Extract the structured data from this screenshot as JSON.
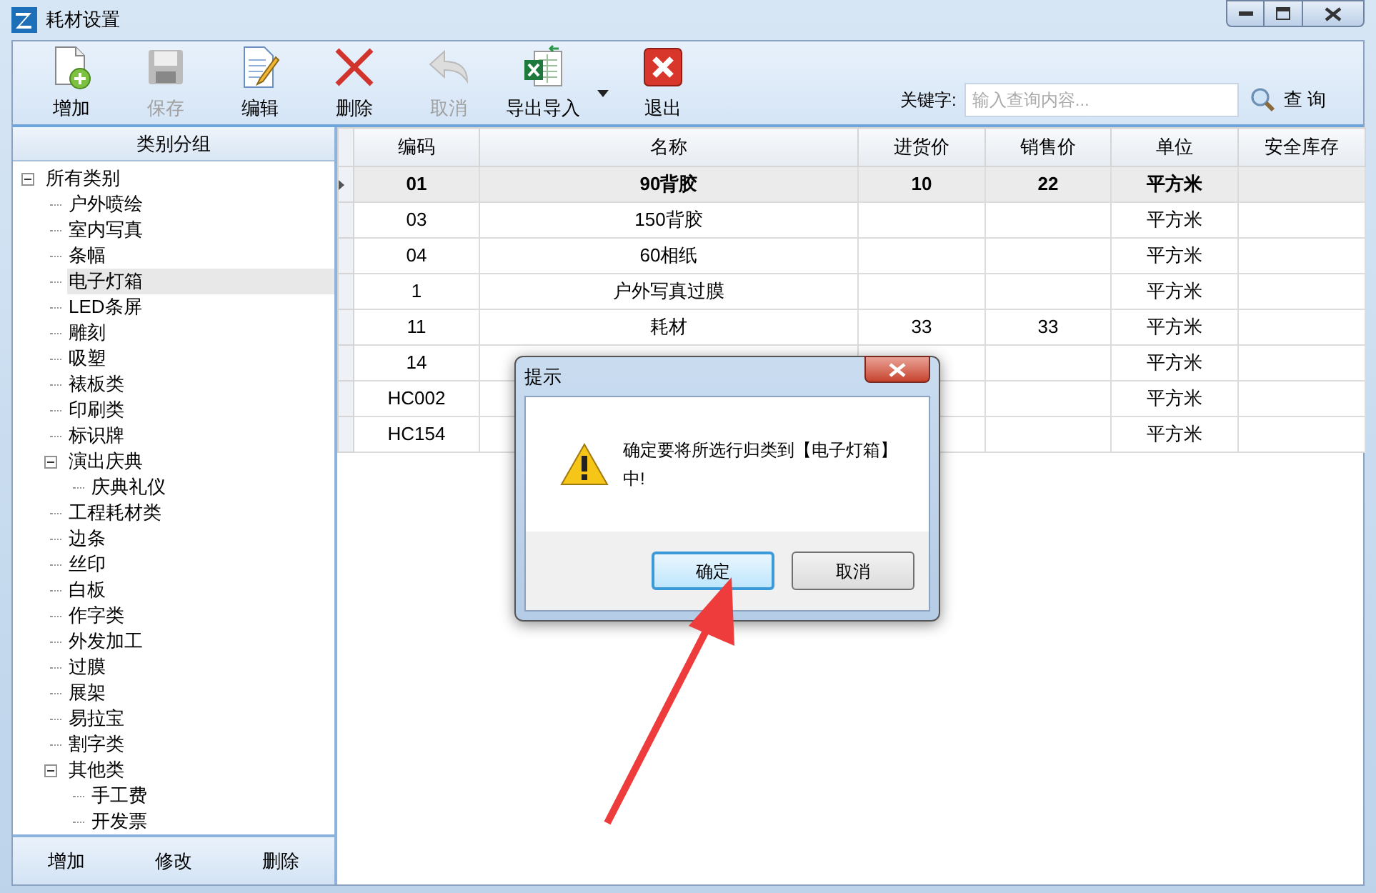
{
  "window": {
    "title": "耗材设置"
  },
  "toolbar": [
    {
      "label": "增加",
      "disabled": false
    },
    {
      "label": "保存",
      "disabled": true
    },
    {
      "label": "编辑",
      "disabled": false
    },
    {
      "label": "删除",
      "disabled": false
    },
    {
      "label": "取消",
      "disabled": true
    },
    {
      "label": "导出导入",
      "disabled": false,
      "dropdown": true
    },
    {
      "label": "退出",
      "disabled": false
    }
  ],
  "search": {
    "label": "关键字:",
    "placeholder": "输入查询内容...",
    "button": "查 询"
  },
  "sidebar": {
    "title": "类别分组",
    "tree": [
      {
        "label": "所有类别",
        "expanded": true,
        "selected": false,
        "children": [
          {
            "label": "户外喷绘",
            "selected": false
          },
          {
            "label": "室内写真",
            "selected": false
          },
          {
            "label": "条幅",
            "selected": false
          },
          {
            "label": "电子灯箱",
            "selected": true
          },
          {
            "label": "LED条屏",
            "selected": false
          },
          {
            "label": "雕刻",
            "selected": false
          },
          {
            "label": "吸塑",
            "selected": false
          },
          {
            "label": "裱板类",
            "selected": false
          },
          {
            "label": "印刷类",
            "selected": false
          },
          {
            "label": "标识牌",
            "selected": false
          },
          {
            "label": "演出庆典",
            "expanded": true,
            "selected": false,
            "children": [
              {
                "label": "庆典礼仪",
                "selected": false
              }
            ]
          },
          {
            "label": "工程耗材类",
            "selected": false
          },
          {
            "label": "边条",
            "selected": false
          },
          {
            "label": "丝印",
            "selected": false
          },
          {
            "label": "白板",
            "selected": false
          },
          {
            "label": "作字类",
            "selected": false
          },
          {
            "label": "外发加工",
            "selected": false
          },
          {
            "label": "过膜",
            "selected": false
          },
          {
            "label": "展架",
            "selected": false
          },
          {
            "label": "易拉宝",
            "selected": false
          },
          {
            "label": "割字类",
            "selected": false
          },
          {
            "label": "其他类",
            "expanded": true,
            "selected": false,
            "children": [
              {
                "label": "手工费",
                "selected": false
              },
              {
                "label": "开发票",
                "selected": false
              }
            ]
          }
        ]
      }
    ],
    "buttons": [
      "增加",
      "修改",
      "删除"
    ]
  },
  "table": {
    "columns": [
      "编码",
      "名称",
      "进货价",
      "销售价",
      "单位",
      "安全库存"
    ],
    "rows": [
      {
        "selected": true,
        "cells": [
          "01",
          "90背胶",
          "10",
          "22",
          "平方米",
          ""
        ]
      },
      {
        "selected": false,
        "cells": [
          "03",
          "150背胶",
          "",
          "",
          "平方米",
          ""
        ]
      },
      {
        "selected": false,
        "cells": [
          "04",
          "60相纸",
          "",
          "",
          "平方米",
          ""
        ]
      },
      {
        "selected": false,
        "cells": [
          "1",
          "户外写真过膜",
          "",
          "",
          "平方米",
          ""
        ]
      },
      {
        "selected": false,
        "cells": [
          "11",
          "耗材",
          "33",
          "33",
          "平方米",
          ""
        ]
      },
      {
        "selected": false,
        "cells": [
          "14",
          "",
          "",
          "",
          "平方米",
          ""
        ]
      },
      {
        "selected": false,
        "cells": [
          "HC002",
          "",
          "",
          "",
          "平方米",
          ""
        ]
      },
      {
        "selected": false,
        "cells": [
          "HC154",
          "",
          "",
          "",
          "平方米",
          ""
        ]
      }
    ]
  },
  "dialog": {
    "title": "提示",
    "message": "确定要将所选行归类到【电子灯箱】中!",
    "buttons": [
      {
        "label": "确定",
        "default": true
      },
      {
        "label": "取消",
        "default": false
      }
    ]
  }
}
